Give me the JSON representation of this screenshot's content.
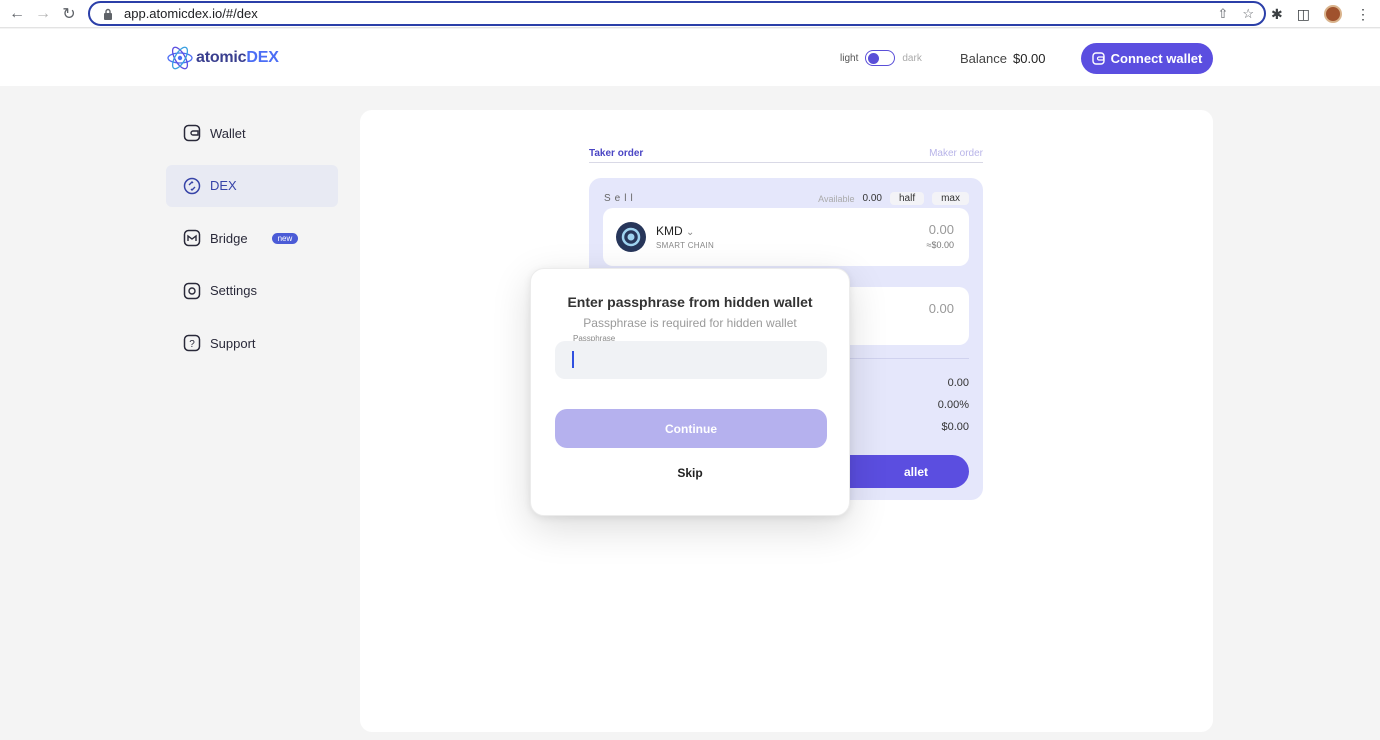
{
  "browser": {
    "url": "app.atomicdex.io/#/dex"
  },
  "header": {
    "logo_prefix": "atomic",
    "logo_suffix": "DEX",
    "theme_light": "light",
    "theme_dark": "dark",
    "balance_label": "Balance",
    "balance_value": "$0.00",
    "connect_label": "Connect wallet",
    "accent": "#5b4ee0"
  },
  "sidebar": {
    "items": [
      {
        "label": "Wallet",
        "icon": "wallet-icon"
      },
      {
        "label": "DEX",
        "icon": "dex-icon",
        "active": true
      },
      {
        "label": "Bridge",
        "icon": "bridge-icon",
        "badge": "new"
      },
      {
        "label": "Settings",
        "icon": "settings-icon"
      },
      {
        "label": "Support",
        "icon": "support-icon"
      }
    ]
  },
  "trade": {
    "tab_taker": "Taker order",
    "tab_maker": "Maker order",
    "sell_label": "Sell",
    "available_label": "Available",
    "available_value": "0.00",
    "half_label": "half",
    "max_label": "max",
    "sell_coin": "KMD",
    "sell_coin_network": "SMART CHAIN",
    "sell_amount": "0.00",
    "sell_usd": "≈$0.00",
    "buy_amount": "0.00",
    "stat_1": "0.00",
    "stat_2": "0.00%",
    "stat_3": "$0.00",
    "connect_tail": "allet"
  },
  "modal": {
    "title": "Enter passphrase from hidden wallet",
    "subtitle": "Passphrase is required for hidden wallet",
    "field_label": "Passphrase",
    "field_value": "",
    "continue_label": "Continue",
    "skip_label": "Skip"
  }
}
